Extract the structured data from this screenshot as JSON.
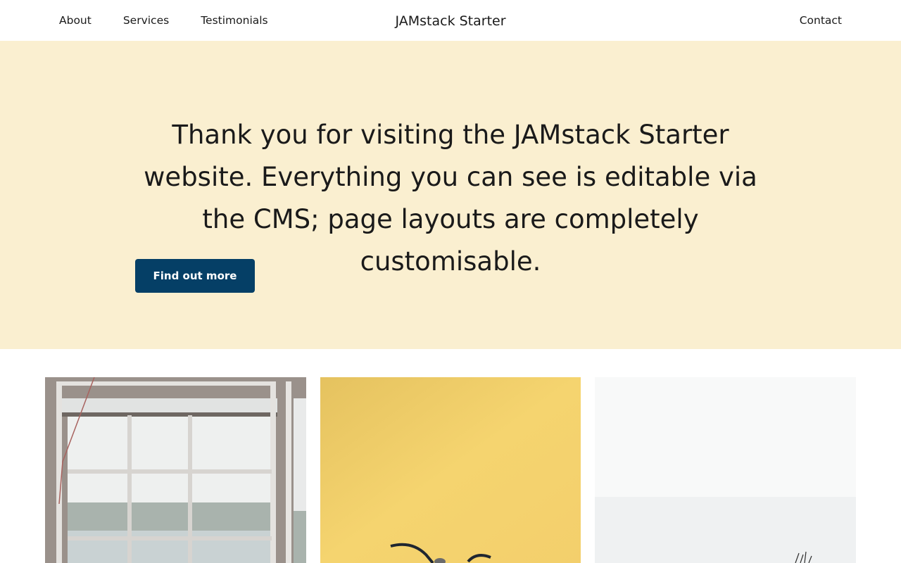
{
  "header": {
    "nav_left": [
      {
        "label": "About"
      },
      {
        "label": "Services"
      },
      {
        "label": "Testimonials"
      }
    ],
    "brand": "JAMstack Starter",
    "nav_right": [
      {
        "label": "Contact"
      }
    ]
  },
  "hero": {
    "text": "Thank you for visiting the JAMstack Starter website. Everything you can see is editable via the CMS; page layouts are completely customisable.",
    "cta_label": "Find out more"
  },
  "colors": {
    "hero_background": "#faefd0",
    "cta_background": "#053f66",
    "cta_text": "#ffffff"
  },
  "gallery": [
    {
      "depicts": "window-by-the-sea"
    },
    {
      "depicts": "bird-on-yellow"
    },
    {
      "depicts": "misty-coast-grass"
    }
  ]
}
